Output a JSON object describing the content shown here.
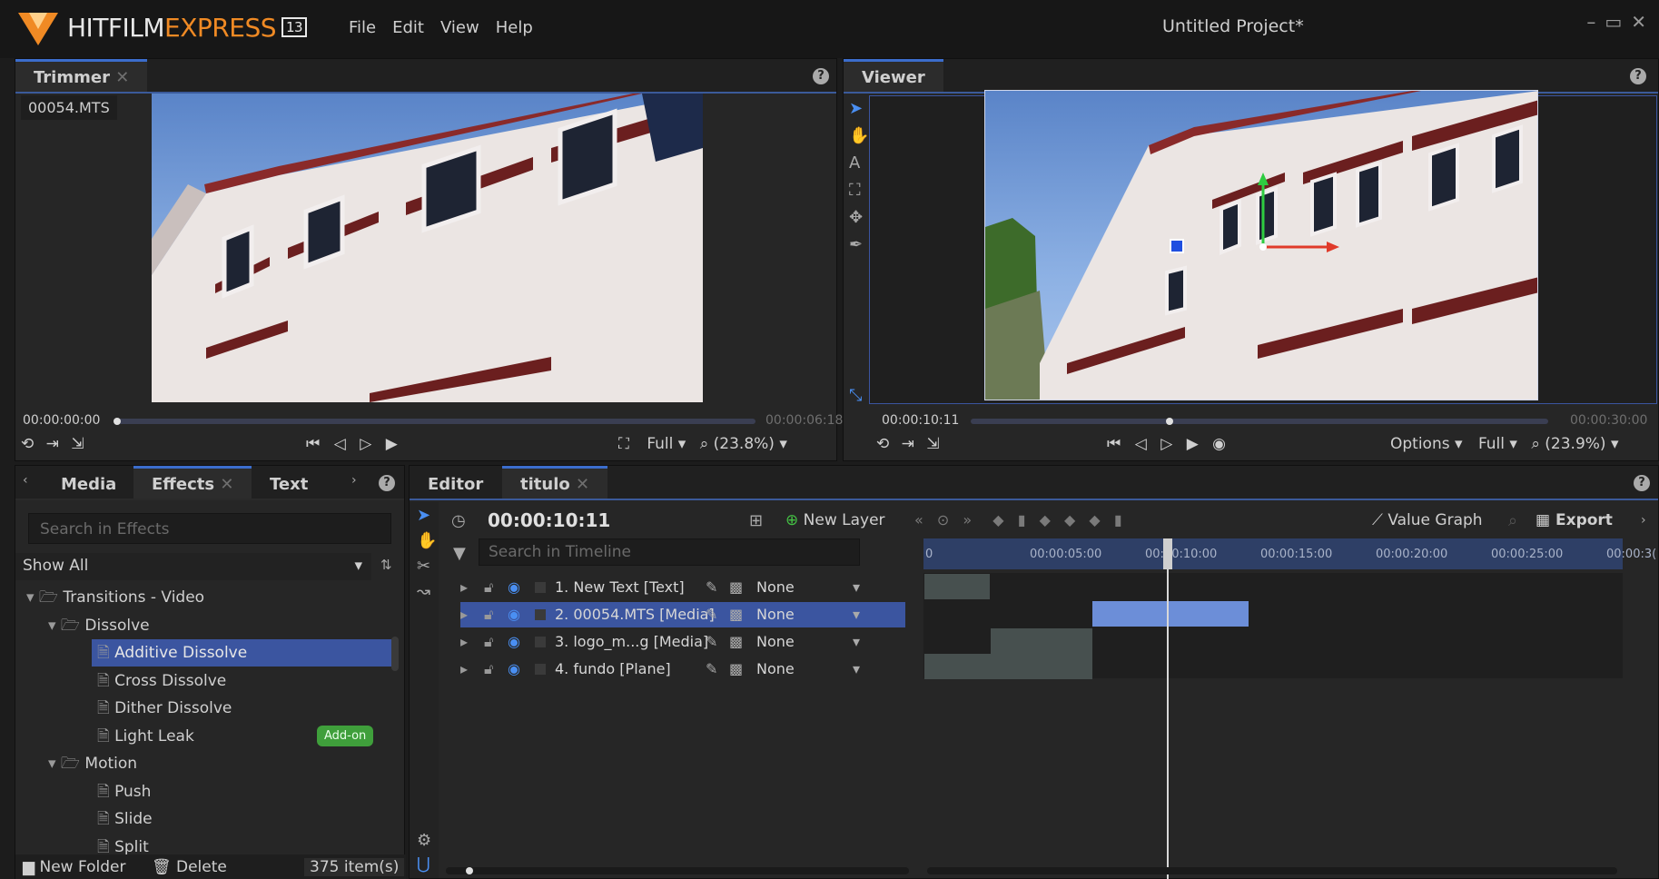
{
  "app": {
    "brand_main": "HITFILM",
    "brand_accent": "EXPRESS",
    "version": "13",
    "project_title": "Untitled Project*",
    "menu": [
      "File",
      "Edit",
      "View",
      "Help"
    ]
  },
  "trimmer": {
    "tab_label": "Trimmer",
    "clip_name": "00054.MTS",
    "time_current": "00:00:00:00",
    "time_total": "00:00:06:18",
    "progress": 0.0,
    "quality": "Full",
    "zoom": "(23.8%)"
  },
  "viewer": {
    "tab_label": "Viewer",
    "time_current": "00:00:10:11",
    "time_total": "00:00:30:00",
    "progress": 0.344,
    "options_label": "Options",
    "quality": "Full",
    "zoom": "(23.9%)"
  },
  "effects_panel": {
    "tabs": [
      "Media",
      "Effects",
      "Text"
    ],
    "search_placeholder": "Search in Effects",
    "filter": "Show All",
    "tree": [
      {
        "label": "Transitions - Video",
        "level": 0,
        "type": "folder"
      },
      {
        "label": "Dissolve",
        "level": 1,
        "type": "folder"
      },
      {
        "label": "Additive Dissolve",
        "level": 2,
        "type": "file",
        "selected": true
      },
      {
        "label": "Cross Dissolve",
        "level": 2,
        "type": "file"
      },
      {
        "label": "Dither Dissolve",
        "level": 2,
        "type": "file"
      },
      {
        "label": "Light Leak",
        "level": 2,
        "type": "file",
        "badge": "Add-on"
      },
      {
        "label": "Motion",
        "level": 1,
        "type": "folder"
      },
      {
        "label": "Push",
        "level": 2,
        "type": "file"
      },
      {
        "label": "Slide",
        "level": 2,
        "type": "file"
      },
      {
        "label": "Split",
        "level": 2,
        "type": "file"
      }
    ],
    "footer": {
      "new_folder": "New Folder",
      "delete": "Delete",
      "count": "375 item(s)"
    }
  },
  "editor": {
    "tabs": [
      "Editor",
      "titulo"
    ],
    "timecode": "00:00:10:11",
    "new_layer_label": "New Layer",
    "search_placeholder": "Search in Timeline",
    "value_graph_label": "Value Graph",
    "export_label": "Export",
    "ruler_ticks": [
      "0",
      "00:00:05:00",
      "00:00:10:00",
      "00:00:15:00",
      "00:00:20:00",
      "00:00:25:00",
      "00:00:3("
    ],
    "layers": [
      {
        "label": "1. New Text [Text]",
        "blend": "None",
        "selected": false
      },
      {
        "label": "2. 00054.MTS [Media]",
        "blend": "None",
        "selected": true
      },
      {
        "label": "3. logo_m...g [Media]",
        "blend": "None",
        "selected": false
      },
      {
        "label": "4. fundo [Plane]",
        "blend": "None",
        "selected": false
      }
    ]
  },
  "colors": {
    "accent_blue": "#3b55a0",
    "tab_highlight": "#3b6dcc",
    "brand_orange": "#f08a24",
    "addon_green": "#3f9f3b"
  }
}
